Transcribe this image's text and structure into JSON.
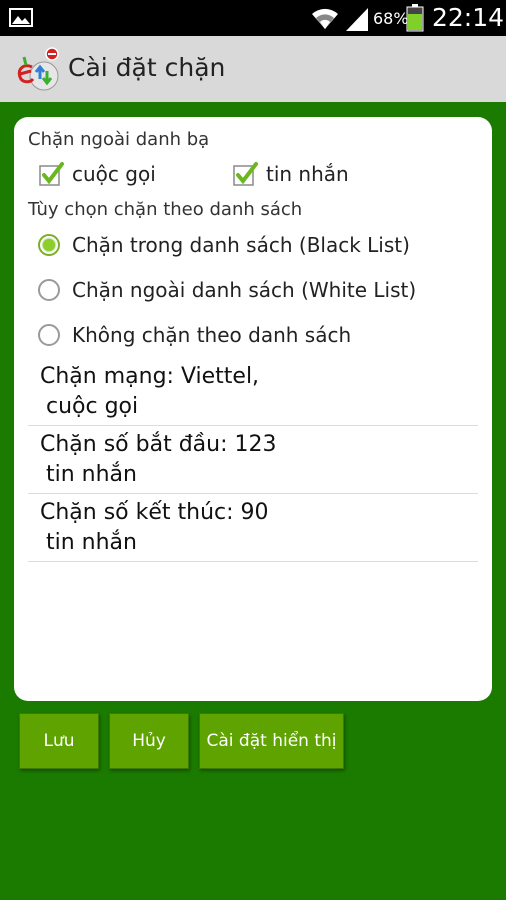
{
  "status_bar": {
    "battery_percent": "68%",
    "time": "22:14"
  },
  "action_bar": {
    "title": "Cài đặt chặn"
  },
  "block_outside_contacts": {
    "label": "Chặn ngoài danh bạ",
    "options": [
      {
        "label": "cuộc gọi",
        "checked": true
      },
      {
        "label": "tin nhắn",
        "checked": true
      }
    ]
  },
  "list_options": {
    "label": "Tùy chọn chặn theo danh sách",
    "options": [
      {
        "label": "Chặn trong danh sách (Black List)",
        "selected": true
      },
      {
        "label": "Chặn ngoài danh sách (White List)",
        "selected": false
      },
      {
        "label": "Không chặn theo danh sách",
        "selected": false
      }
    ]
  },
  "rules": [
    {
      "line1": "Chặn mạng: Viettel,",
      "line2": "cuộc gọi"
    },
    {
      "line1": "Chặn số bắt đầu: 123",
      "line2": "tin nhắn"
    },
    {
      "line1": "Chặn số kết thúc: 90",
      "line2": "tin nhắn"
    }
  ],
  "buttons": {
    "save": "Lưu",
    "cancel": "Hủy",
    "display_settings": "Cài đặt hiển thị"
  },
  "colors": {
    "background": "#1b7a00",
    "button": "#5ea300",
    "accent_check": "#6ab81e"
  }
}
